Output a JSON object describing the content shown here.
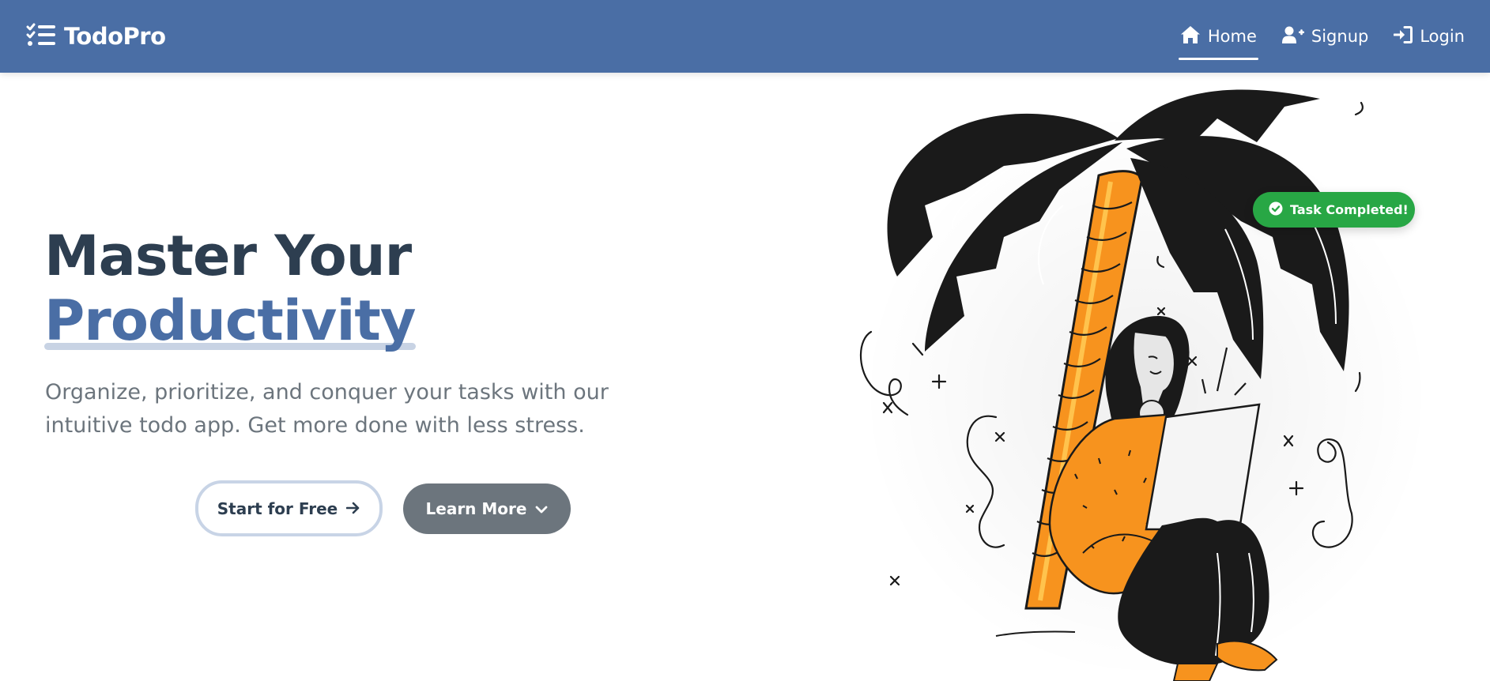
{
  "brand": {
    "name": "TodoPro",
    "icon": "list-check-icon"
  },
  "nav": {
    "items": [
      {
        "label": "Home",
        "icon": "home-icon",
        "active": true
      },
      {
        "label": "Signup",
        "icon": "user-plus-icon",
        "active": false
      },
      {
        "label": "Login",
        "icon": "sign-in-icon",
        "active": false
      }
    ]
  },
  "hero": {
    "title_line1": "Master Your",
    "title_line2": "Productivity",
    "subtitle": "Organize, prioritize, and conquer your tasks with our intuitive todo app. Get more done with less stress.",
    "primary_button": "Start for Free",
    "secondary_button": "Learn More"
  },
  "toast": {
    "text": "Task Completed!",
    "icon": "check-circle-icon"
  },
  "colors": {
    "navbar": "#4a6ea5",
    "accent": "#4a6ea5",
    "heading": "#2d3e50",
    "muted": "#6c757d",
    "success": "#28a745",
    "illustration_orange": "#f7931e",
    "illustration_dark": "#1a1a1a"
  }
}
